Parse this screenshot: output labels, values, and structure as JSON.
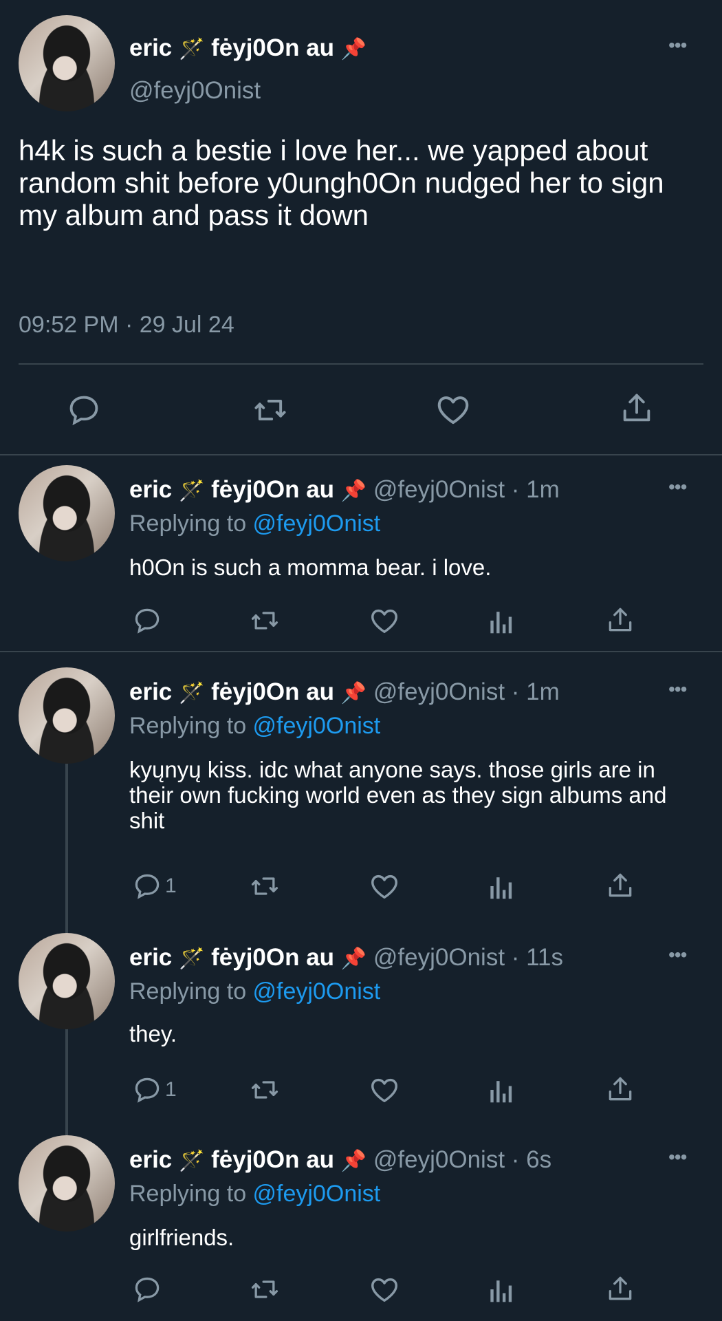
{
  "main_tweet": {
    "display_name": "eric",
    "name_suffix": "fėyj0On au",
    "wand_emoji": "🪄",
    "pin_emoji": "📌",
    "handle": "@feyj0Onist",
    "text": "h4k is such a bestie i love her... we yapped about random shit before y0ungh0On nudged her to sign my album and pass it down",
    "timestamp": "09:52 PM · 29 Jul 24"
  },
  "replies": [
    {
      "display_name": "eric",
      "name_suffix": "fėyj0On au",
      "handle_time": "@feyj0Onist · 1m",
      "replying_prefix": "Replying to ",
      "replying_handle": "@feyj0Onist",
      "text": "h0On is such a momma bear. i love.",
      "reply_count": ""
    },
    {
      "display_name": "eric",
      "name_suffix": "fėyj0On au",
      "handle_time": "@feyj0Onist · 1m",
      "replying_prefix": "Replying to ",
      "replying_handle": "@feyj0Onist",
      "text": "kyųnyų kiss. idc what anyone says. those girls are in their own fucking world even as they sign albums and shit",
      "reply_count": "1"
    },
    {
      "display_name": "eric",
      "name_suffix": "fėyj0On au",
      "handle_time": "@feyj0Onist · 11s",
      "replying_prefix": "Replying to ",
      "replying_handle": "@feyj0Onist",
      "text": "they.",
      "reply_count": "1"
    },
    {
      "display_name": "eric",
      "name_suffix": "fėyj0On au",
      "handle_time": "@feyj0Onist · 6s",
      "replying_prefix": "Replying to ",
      "replying_handle": "@feyj0Onist",
      "text": "girlfriends.",
      "reply_count": ""
    }
  ],
  "colors": {
    "background": "#15202b",
    "secondary_text": "#8899a6",
    "link": "#1d9bf0",
    "divider": "#38444d"
  },
  "icons": [
    "reply-icon",
    "retweet-icon",
    "like-icon",
    "analytics-icon",
    "share-icon",
    "more-icon"
  ]
}
